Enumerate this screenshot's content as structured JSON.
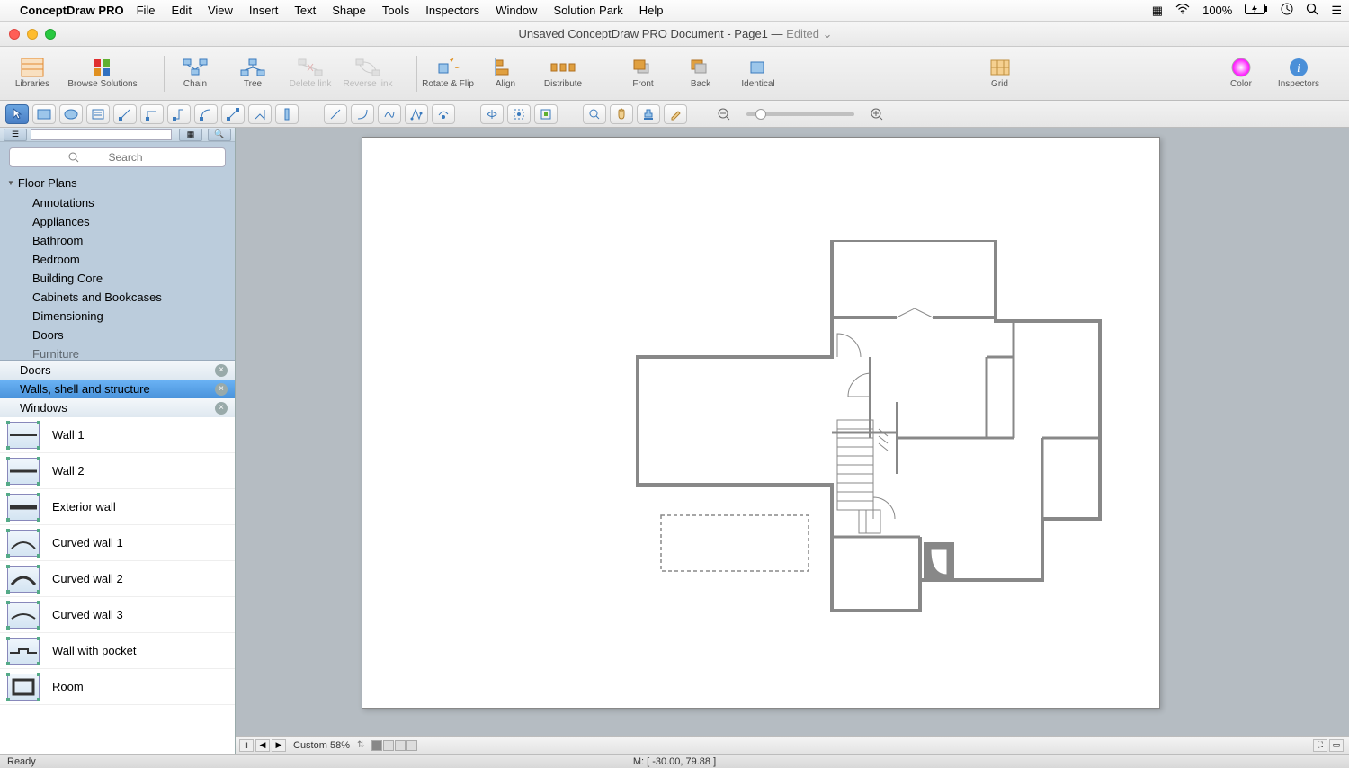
{
  "menubar": {
    "appname": "ConceptDraw PRO",
    "items": [
      "File",
      "Edit",
      "View",
      "Insert",
      "Text",
      "Shape",
      "Tools",
      "Inspectors",
      "Window",
      "Solution Park",
      "Help"
    ],
    "battery": "100%"
  },
  "titlebar": {
    "doc": "Unsaved ConceptDraw PRO Document - Page1",
    "sep": "—",
    "edited": "Edited"
  },
  "toolbar": {
    "libraries": "Libraries",
    "browse": "Browse Solutions",
    "chain": "Chain",
    "tree": "Tree",
    "deletelink": "Delete link",
    "reverselink": "Reverse link",
    "rotateflip": "Rotate & Flip",
    "align": "Align",
    "distribute": "Distribute",
    "front": "Front",
    "back": "Back",
    "identical": "Identical",
    "grid": "Grid",
    "color": "Color",
    "inspectors": "Inspectors"
  },
  "sidebar": {
    "search_placeholder": "Search",
    "tree_header": "Floor Plans",
    "tree_items": [
      "Annotations",
      "Appliances",
      "Bathroom",
      "Bedroom",
      "Building Core",
      "Cabinets and Bookcases",
      "Dimensioning",
      "Doors",
      "Furniture"
    ],
    "libs": {
      "doors": "Doors",
      "walls": "Walls, shell and structure",
      "windows": "Windows"
    },
    "shapes": [
      "Wall 1",
      "Wall 2",
      "Exterior wall",
      "Curved wall 1",
      "Curved wall 2",
      "Curved wall 3",
      "Wall with pocket",
      "Room"
    ]
  },
  "canvas_status": {
    "zoom": "Custom 58%"
  },
  "statusbar": {
    "ready": "Ready",
    "mouse": "M: [ -30.00, 79.88 ]"
  }
}
